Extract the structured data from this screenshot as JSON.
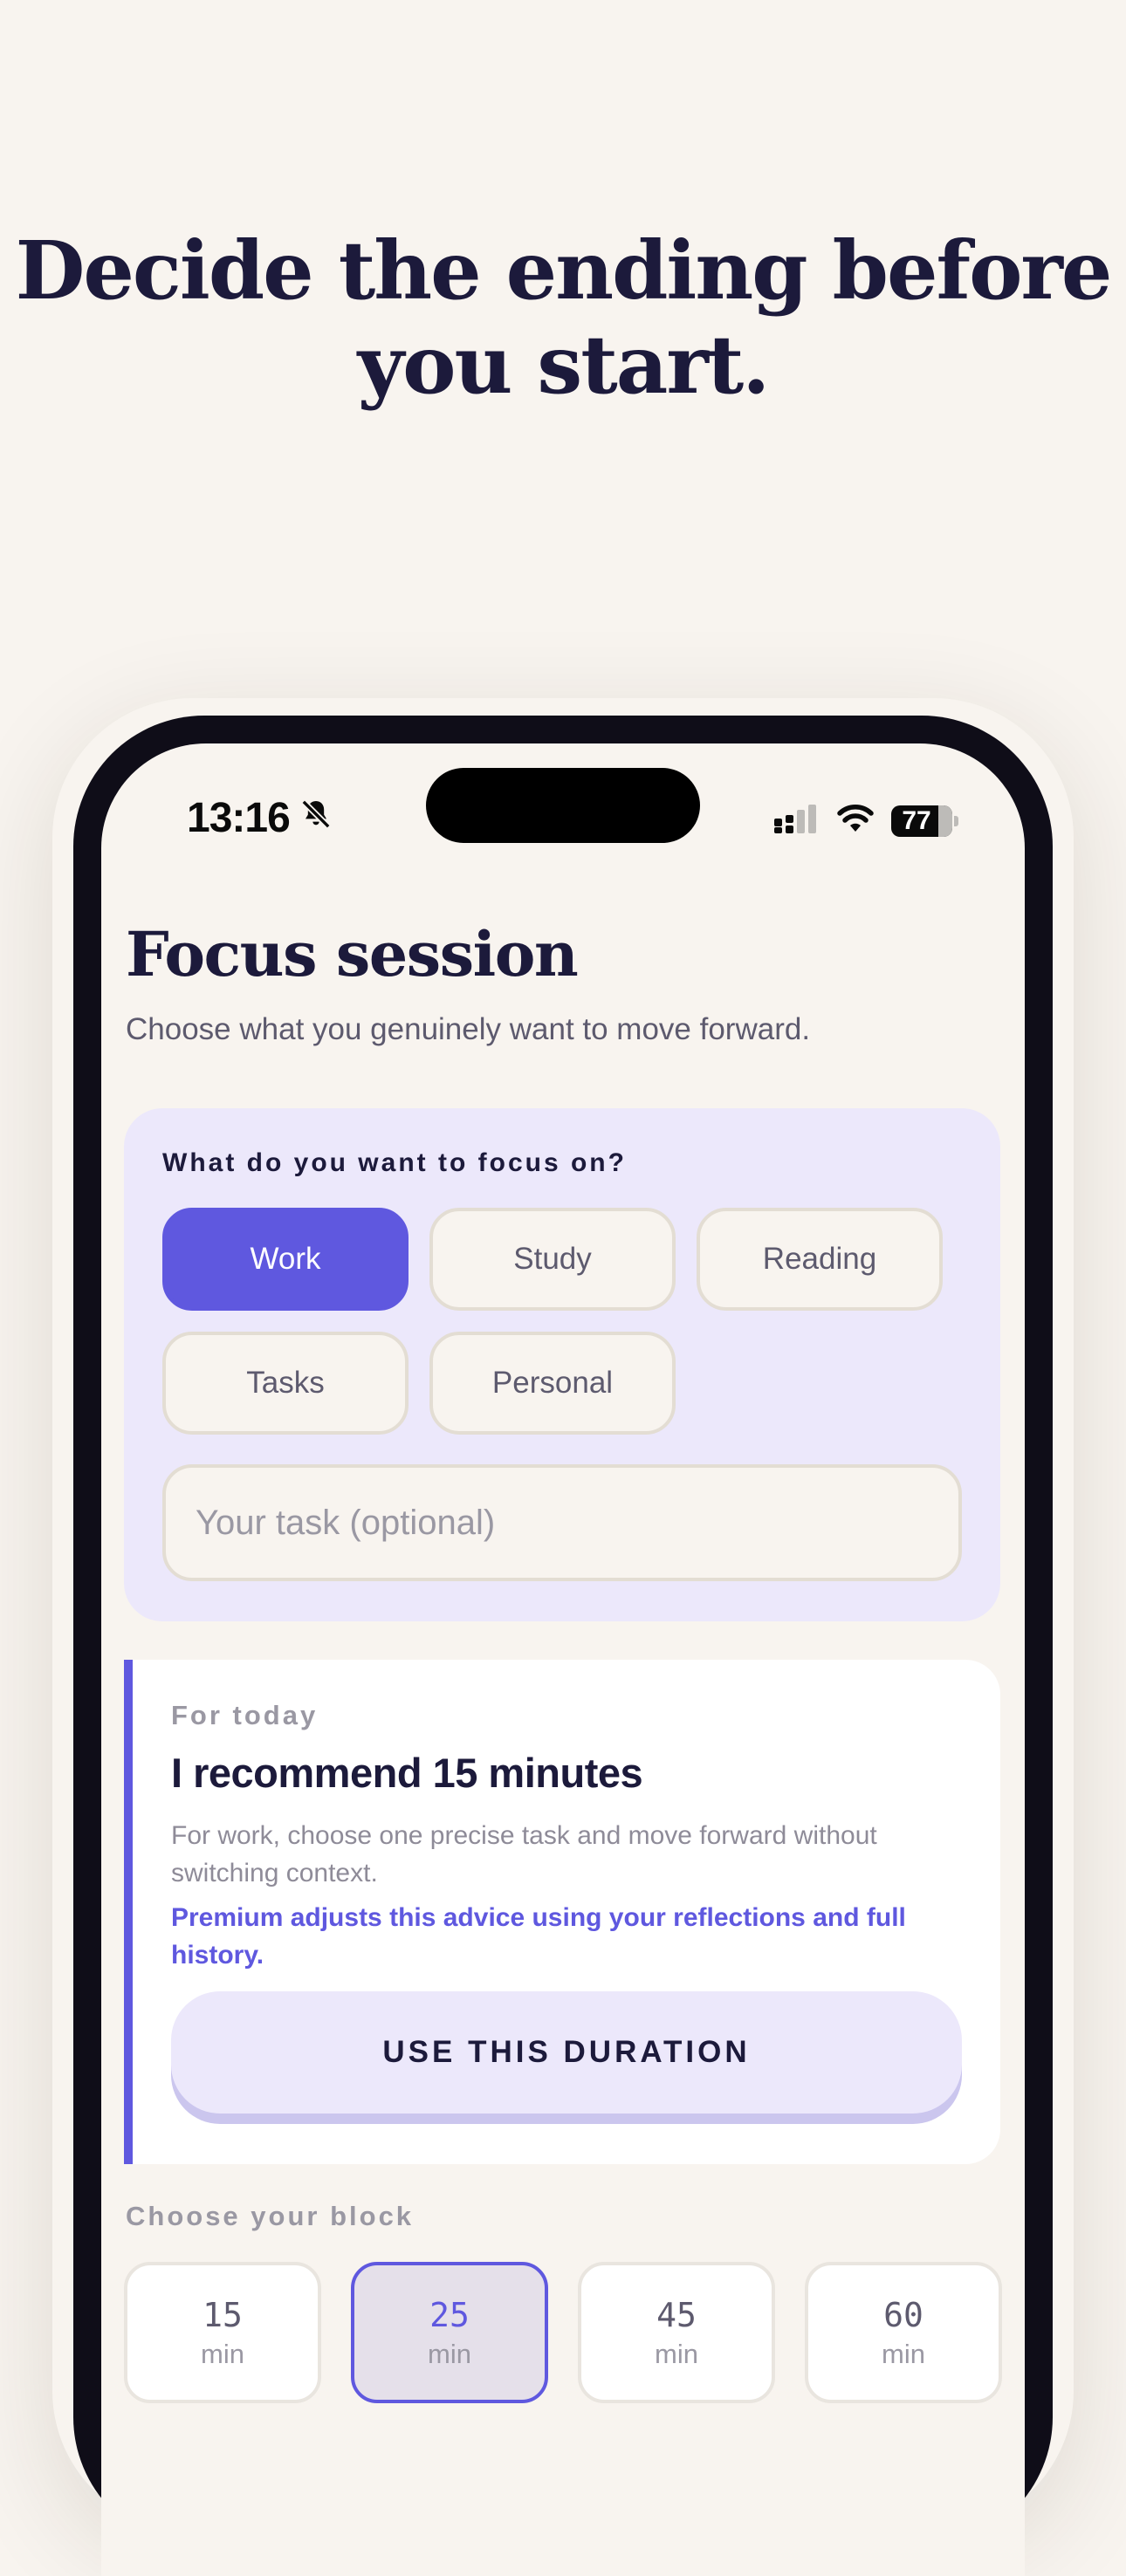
{
  "headline": {
    "line1": "Decide the ending before",
    "line2": "you start."
  },
  "status_bar": {
    "time": "13:16",
    "battery": "77"
  },
  "screen": {
    "title": "Focus session",
    "subtitle": "Choose what you genuinely want to move forward."
  },
  "focus": {
    "question": "What do you want to focus on?",
    "chips": [
      "Work",
      "Study",
      "Reading",
      "Tasks",
      "Personal"
    ],
    "selected": "Work",
    "task_placeholder": "Your task (optional)"
  },
  "recommendation": {
    "kicker": "For today",
    "title": "I recommend 15 minutes",
    "body": "For work, choose one precise task and move forward without switching context.",
    "premium": "Premium adjusts this advice using your reflections and full history.",
    "button": "USE THIS DURATION"
  },
  "blocks": {
    "label": "Choose your block",
    "options": [
      {
        "value": "15",
        "unit": "min"
      },
      {
        "value": "25",
        "unit": "min"
      },
      {
        "value": "45",
        "unit": "min"
      },
      {
        "value": "60",
        "unit": "min"
      }
    ],
    "selected": "25"
  },
  "colors": {
    "accent": "#5f58df",
    "ink": "#1c1a3b",
    "background": "#f8f4ef",
    "card_lavender": "#ece8fb"
  },
  "icons": {
    "muted": "bell-slash-icon",
    "signal": "cellular-signal-icon",
    "wifi": "wifi-icon",
    "battery": "battery-icon"
  }
}
